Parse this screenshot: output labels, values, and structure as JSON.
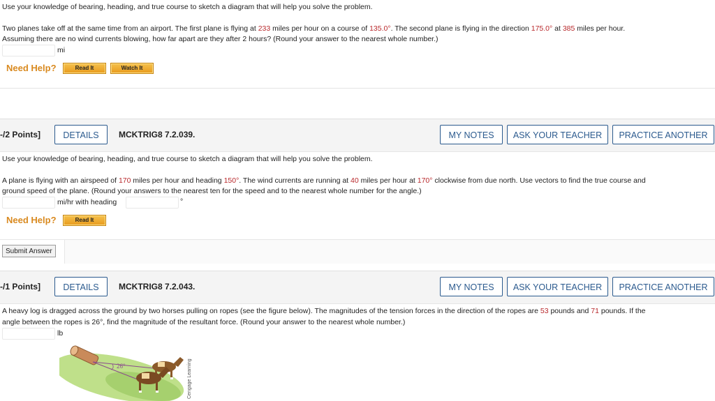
{
  "q1": {
    "instruction": "Use your knowledge of bearing, heading, and true course to sketch a diagram that will help you solve the problem.",
    "line1_a": "Two planes take off at the same time from an airport. The first plane is flying at ",
    "v233": "233",
    "line1_b": " miles per hour on a course of ",
    "v135": "135.0°",
    "line1_c": ". The second plane is flying in the direction ",
    "v175": "175.0°",
    "line1_d": " at ",
    "v385": "385",
    "line1_e": " miles per hour.",
    "line2": "Assuming there are no wind currents blowing, how far apart are they after 2 hours? (Round your answer to the nearest whole number.)",
    "unit": "mi",
    "need_help": "Need Help?",
    "read_it": "Read It",
    "watch_it": "Watch It"
  },
  "q2": {
    "points": "-/2 Points]",
    "details": "DETAILS",
    "code": "MCKTRIG8 7.2.039.",
    "my_notes": "MY NOTES",
    "ask_teacher": "ASK YOUR TEACHER",
    "practice": "PRACTICE ANOTHER",
    "instruction": "Use your knowledge of bearing, heading, and true course to sketch a diagram that will help you solve the problem.",
    "p_a": "A plane is flying with an airspeed of ",
    "v170": "170",
    "p_b": " miles per hour and heading ",
    "v150": "150°",
    "p_c": ". The wind currents are running at ",
    "v40": "40",
    "p_d": " miles per hour at ",
    "v170deg": "170°",
    "p_e": " clockwise from due north. Use vectors to find the true course and",
    "p_line2": "ground speed of the plane. (Round your answers to the nearest ten for the speed and to the nearest whole number for the angle.)",
    "unit": "mi/hr with heading",
    "degree": "°",
    "need_help": "Need Help?",
    "read_it": "Read It",
    "submit": "Submit Answer"
  },
  "q3": {
    "points": "-/1 Points]",
    "details": "DETAILS",
    "code": "MCKTRIG8 7.2.043.",
    "my_notes": "MY NOTES",
    "ask_teacher": "ASK YOUR TEACHER",
    "practice": "PRACTICE ANOTHER",
    "p_a": "A heavy log is dragged across the ground by two horses pulling on ropes (see the figure below). The magnitudes of the tension forces in the direction of the ropes are ",
    "v53": "53",
    "p_b": " pounds and ",
    "v71": "71",
    "p_c": " pounds. If the",
    "p_line2": "angle between the ropes is 26°, find the magnitude of the resultant force. (Round your answer to the nearest whole number.)",
    "unit": "lb",
    "figure_angle": "26°",
    "figure_credit": "Cengage Learning"
  }
}
